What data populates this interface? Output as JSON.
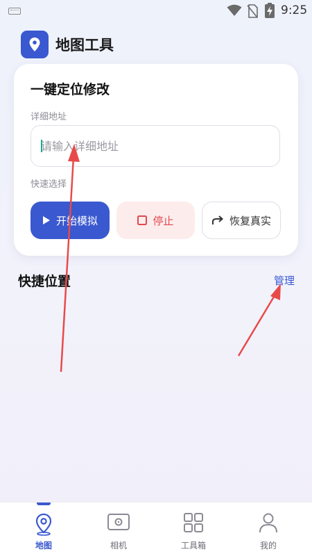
{
  "status_bar": {
    "time": "9:25",
    "icons": [
      "keyboard-icon",
      "wifi-icon",
      "no-sim-icon",
      "battery-charging-icon"
    ]
  },
  "header": {
    "title": "地图工具",
    "logo_icon": "location-pin-icon"
  },
  "card": {
    "title": "一键定位修改",
    "address_label": "详细地址",
    "address_placeholder": "请输入详细地址",
    "address_value": "",
    "quick_select_label": "快速选择",
    "buttons": {
      "start": "开始模拟",
      "stop": "停止",
      "restore": "恢复真实"
    }
  },
  "quick_positions": {
    "title": "快捷位置",
    "manage_label": "管理"
  },
  "bottom_nav": {
    "items": [
      {
        "label": "地图",
        "icon": "map-pin-icon",
        "active": true
      },
      {
        "label": "相机",
        "icon": "camera-icon",
        "active": false
      },
      {
        "label": "工具箱",
        "icon": "toolbox-grid-icon",
        "active": false
      },
      {
        "label": "我的",
        "icon": "profile-icon",
        "active": false
      }
    ]
  },
  "colors": {
    "accent": "#3a58cf",
    "stop_bg": "#fdecec",
    "stop_text": "#e0484e",
    "annotation_arrow": "#e84a4a"
  }
}
